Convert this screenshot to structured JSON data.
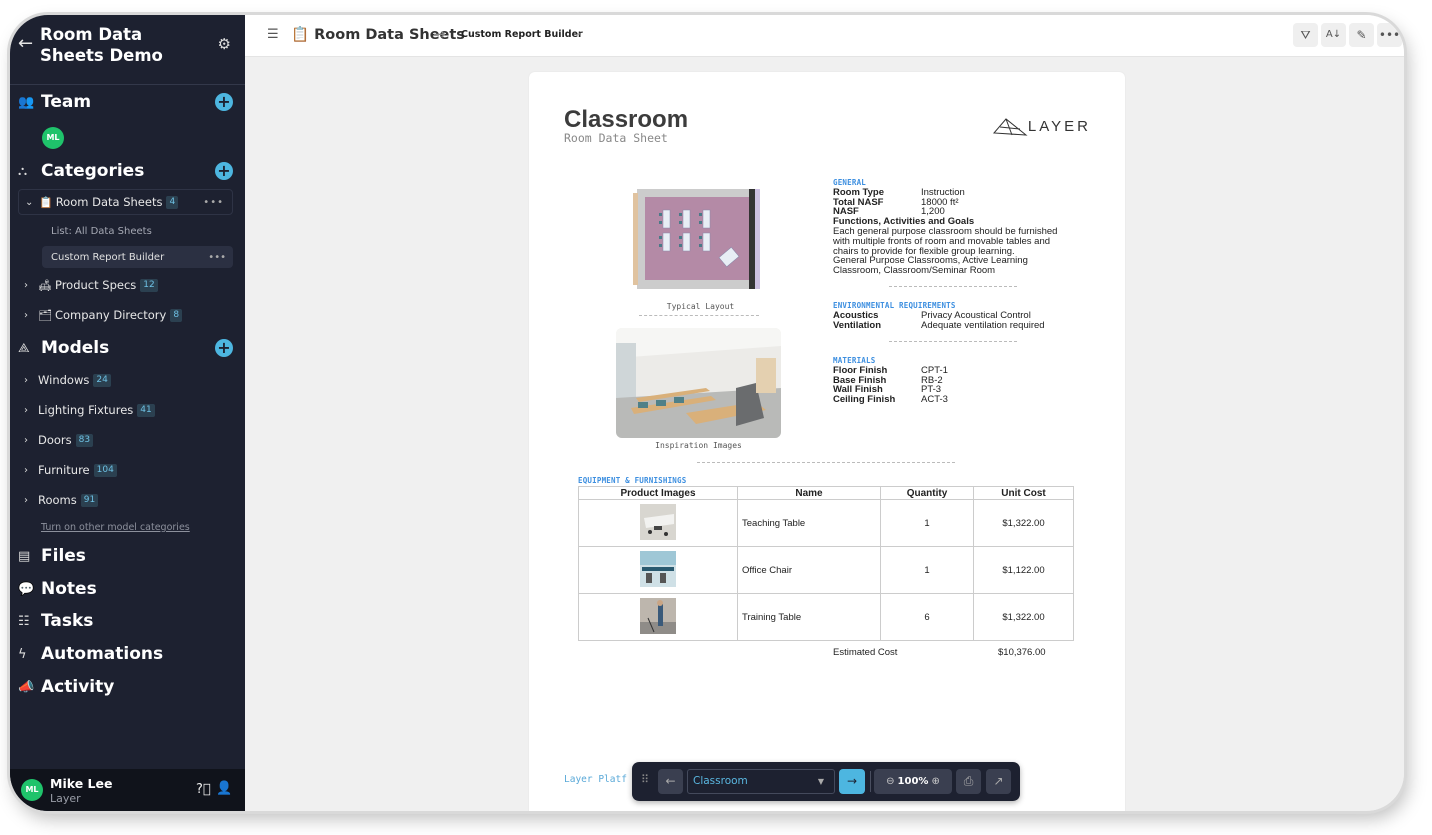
{
  "sidebar": {
    "workspace_title": "Room Data Sheets Demo",
    "sections": {
      "team": "Team",
      "categories": "Categories",
      "models": "Models",
      "files": "Files",
      "notes": "Notes",
      "tasks": "Tasks",
      "automations": "Automations",
      "activity": "Activity"
    },
    "team_member_initials": "ML",
    "categories": [
      {
        "label": "Room Data Sheets",
        "count": "4",
        "emoji": "📋",
        "expanded": true
      },
      {
        "label": "Product Specs",
        "count": "12",
        "emoji": "🛋"
      },
      {
        "label": "Company Directory",
        "count": "8",
        "emoji": "🗂"
      }
    ],
    "category_views": [
      {
        "label": "List: All Data Sheets"
      },
      {
        "label": "Custom Report Builder",
        "active": true
      }
    ],
    "models": [
      {
        "label": "Windows",
        "count": "24"
      },
      {
        "label": "Lighting Fixtures",
        "count": "41"
      },
      {
        "label": "Doors",
        "count": "83"
      },
      {
        "label": "Furniture",
        "count": "104"
      },
      {
        "label": "Rooms",
        "count": "91"
      }
    ],
    "models_link": "Turn on other model categories",
    "user": {
      "initials": "ML",
      "name": "Mike Lee",
      "org": "Layer"
    }
  },
  "topbar": {
    "breadcrumb_parent": "Room Data Sheets",
    "breadcrumb_view": "Custom Report Builder",
    "actions": [
      "filter",
      "sort",
      "edit",
      "more"
    ]
  },
  "document": {
    "title": "Classroom",
    "subtitle": "Room Data Sheet",
    "logo_text": "LAYER",
    "layout_caption": "Typical Layout",
    "inspiration_caption": "Inspiration Images",
    "general": {
      "label": "GENERAL",
      "room_type_k": "Room Type",
      "room_type_v": "Instruction",
      "total_nasf_k": "Total NASF",
      "total_nasf_v": "18000 ft²",
      "nasf_k": "NASF",
      "nasf_v": "1,200",
      "functions_k": "Functions, Activities and Goals",
      "functions_v": "Each general purpose classroom should be furnished with multiple fronts of room and movable tables and chairs to provide for flexible group learning.",
      "types_v": "General Purpose Classrooms, Active Learning Classroom, Classroom/Seminar Room"
    },
    "environmental": {
      "label": "ENVIRONMENTAL REQUIREMENTS",
      "acoustics_k": "Acoustics",
      "acoustics_v": "Privacy Acoustical Control",
      "ventilation_k": "Ventilation",
      "ventilation_v": "Adequate ventilation required"
    },
    "materials": {
      "label": "MATERIALS",
      "floor_k": "Floor Finish",
      "floor_v": "CPT-1",
      "base_k": "Base Finish",
      "base_v": "RB-2",
      "wall_k": "Wall Finish",
      "wall_v": "PT-3",
      "ceiling_k": "Ceiling Finish",
      "ceiling_v": "ACT-3"
    },
    "equipment": {
      "label": "EQUIPMENT & FURNISHINGS",
      "headers": [
        "Product Images",
        "Name",
        "Quantity",
        "Unit Cost"
      ],
      "rows": [
        {
          "name": "Teaching Table",
          "qty": "1",
          "cost": "$1,322.00"
        },
        {
          "name": "Office Chair",
          "qty": "1",
          "cost": "$1,122.00"
        },
        {
          "name": "Training Table",
          "qty": "6",
          "cost": "$1,322.00"
        }
      ],
      "estimated_label": "Estimated Cost",
      "estimated_value": "$10,376.00"
    },
    "footer_text": "Layer Platf"
  },
  "floating_toolbar": {
    "selected_record": "Classroom",
    "zoom_level": "100%"
  }
}
